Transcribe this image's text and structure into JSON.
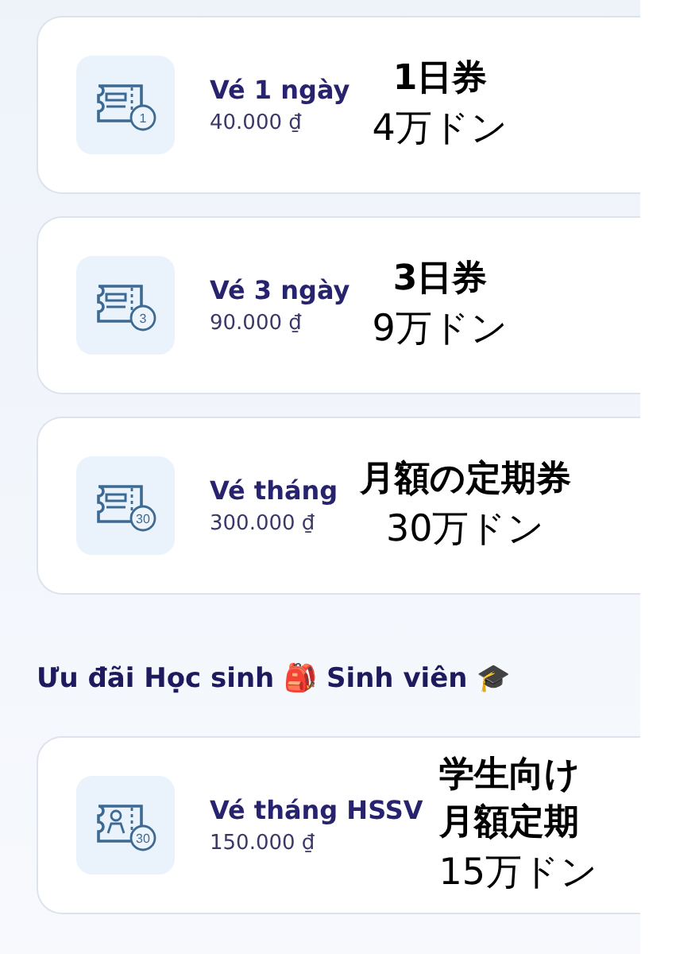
{
  "tickets": [
    {
      "kind": "standard",
      "name": "Vé 1 ngày",
      "price": "40.000 ₫",
      "badge": "1",
      "annotation": {
        "title": [
          "1日券"
        ],
        "price": "4万ドン"
      }
    },
    {
      "kind": "standard",
      "name": "Vé 3 ngày",
      "price": "90.000 ₫",
      "badge": "3",
      "annotation": {
        "title": [
          "3日券"
        ],
        "price": "9万ドン"
      }
    },
    {
      "kind": "standard",
      "name": "Vé tháng",
      "price": "300.000 ₫",
      "badge": "30",
      "annotation": {
        "title": [
          "月額の定期券"
        ],
        "price": "30万ドン"
      }
    }
  ],
  "student_section": {
    "heading": "Ưu đãi Học sinh 🎒 Sinh viên 🎓",
    "tickets": [
      {
        "kind": "student",
        "name": "Vé tháng HSSV",
        "price": "150.000 ₫",
        "badge": "30",
        "annotation": {
          "title": [
            "学生向け",
            "月額定期"
          ],
          "price": "15万ドン"
        }
      }
    ]
  }
}
